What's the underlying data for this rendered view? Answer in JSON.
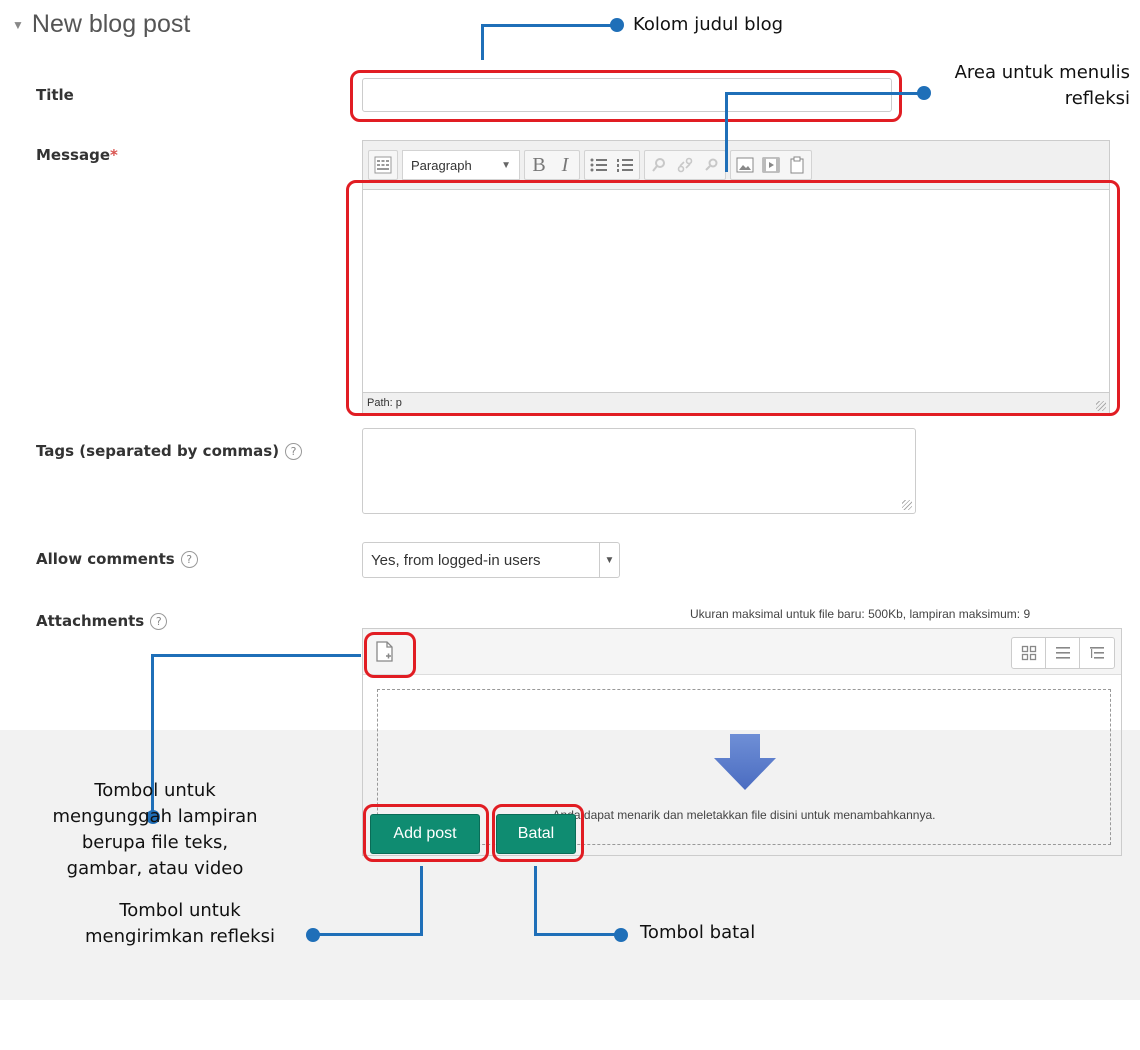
{
  "header": {
    "title": "New blog post"
  },
  "form": {
    "title_label": "Title",
    "message_label": "Message",
    "required_marker": "*",
    "tags_label": "Tags (separated by commas)",
    "comments_label": "Allow comments",
    "comments_value": "Yes, from logged-in users",
    "attachments_label": "Attachments",
    "help_glyph": "?"
  },
  "editor": {
    "format_value": "Paragraph",
    "path_text": "Path: p",
    "tools": [
      "toolbar-toggle-icon",
      "bold-icon",
      "italic-icon",
      "bullet-list-icon",
      "numbered-list-icon",
      "link-icon",
      "unlink-icon",
      "anchor-icon",
      "image-icon",
      "media-icon",
      "paste-icon"
    ]
  },
  "attachments": {
    "limit_text": "Ukuran maksimal untuk file baru: 500Kb, lampiran maksimum: 9",
    "drop_text": "Anda dapat menarik dan meletakkan file disini untuk menambahkannya."
  },
  "buttons": {
    "add_post": "Add post",
    "cancel": "Batal"
  },
  "annotations": {
    "title_field": "Kolom judul blog",
    "message_area": "Area untuk menulis refleksi",
    "upload": "Tombol untuk mengunggah lampiran berupa file teks, gambar, atau video",
    "submit": "Tombol untuk mengirimkan refleksi",
    "cancel": "Tombol batal"
  },
  "colors": {
    "accent": "#0f8c71",
    "highlight": "#e11d23",
    "callout_line": "#1f6fb8"
  }
}
